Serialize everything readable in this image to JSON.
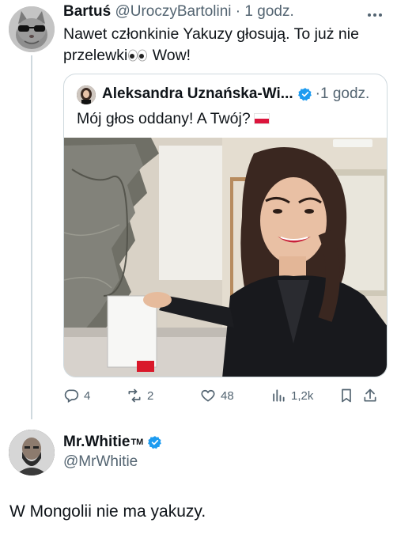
{
  "tweet1": {
    "author_name": "Bartuś",
    "handle": "@UroczyBartolini",
    "separator": "·",
    "time": "1 godz.",
    "more_icon": "more-dots-icon",
    "text_line1": "Nawet członkinie Yakuzy głosują. To już nie",
    "text_line2": "przelewki",
    "text_line2_end": "Wow!",
    "emoji_icon": "eyes-emoji-icon"
  },
  "quote": {
    "author_name": "Aleksandra Uznańska-Wi...",
    "separator": "·",
    "time": "1 godz.",
    "text": "Mój głos oddany! A Twój?",
    "flag_icon": "poland-flag-icon",
    "verified_color": "#1d9bf0"
  },
  "actions": {
    "replies": "4",
    "reposts": "2",
    "likes": "48",
    "views": "1,2k"
  },
  "tweet2": {
    "author_name": "Mr.Whitie",
    "trademark": "TM",
    "handle": "@MrWhitie",
    "text": "W Mongolii nie ma yakuzy."
  },
  "colors": {
    "text": "#0f1419",
    "muted": "#536471",
    "border": "#cfd9de",
    "accent": "#1d9bf0"
  }
}
